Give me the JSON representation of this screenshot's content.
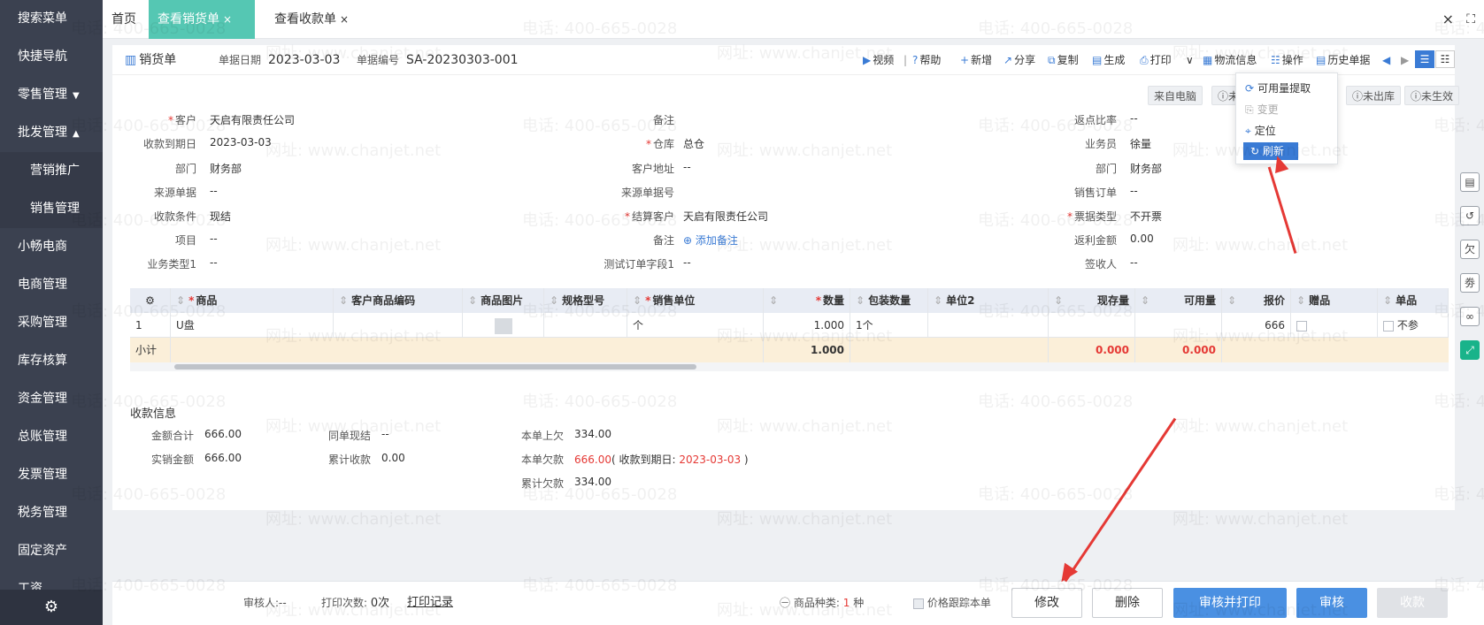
{
  "sidebar": {
    "items": [
      {
        "label": "搜索菜单"
      },
      {
        "label": "快捷导航"
      },
      {
        "label": "零售管理",
        "arrow": "▼"
      },
      {
        "label": "批发管理",
        "arrow": "▲"
      },
      {
        "label": "营销推广",
        "sub": true
      },
      {
        "label": "销售管理",
        "sub": true
      },
      {
        "label": "小畅电商"
      },
      {
        "label": "电商管理"
      },
      {
        "label": "采购管理"
      },
      {
        "label": "库存核算"
      },
      {
        "label": "资金管理"
      },
      {
        "label": "总账管理"
      },
      {
        "label": "发票管理"
      },
      {
        "label": "税务管理"
      },
      {
        "label": "固定资产"
      },
      {
        "label": "工资"
      }
    ],
    "settings_icon": "⚙"
  },
  "tabs": [
    {
      "label": "首页",
      "closable": false
    },
    {
      "label": "查看销货单",
      "closable": true,
      "active": true
    },
    {
      "label": "查看收款单",
      "closable": true
    }
  ],
  "tab_close_glyph": "×",
  "window_close": "×",
  "window_fullscreen": "⛶",
  "toolbar": {
    "doc_title": "销货单",
    "date_label": "单据日期",
    "date_value": "2023-03-03",
    "no_label": "单据编号",
    "no_value": "SA-20230303-001",
    "buttons": [
      {
        "label": "视频",
        "icon": "▶"
      },
      {
        "label": "帮助",
        "icon": "?"
      },
      {
        "label": "新增",
        "icon": "+"
      },
      {
        "label": "分享",
        "icon": "↗"
      },
      {
        "label": "复制",
        "icon": "⧉"
      },
      {
        "label": "生成",
        "icon": "▤"
      },
      {
        "label": "打印",
        "icon": "⎙"
      },
      {
        "label": "物流信息",
        "icon": "▦"
      },
      {
        "label": "操作",
        "icon": "☷"
      },
      {
        "label": "历史单据",
        "icon": "▤"
      }
    ],
    "separator": "|",
    "print_dropdown": "∨",
    "nav_prev": "◀",
    "nav_next": "▶",
    "view_list": "☰",
    "view_detail": "☷"
  },
  "status_chips": [
    "来自电脑",
    "未",
    "未出库",
    "未生效"
  ],
  "operation_menu": {
    "items": [
      {
        "label": "可用量提取",
        "icon": "⟳",
        "disabled": false
      },
      {
        "label": "变更",
        "icon": "⎘",
        "disabled": true
      },
      {
        "label": "定位",
        "icon": "⌖",
        "disabled": false
      }
    ],
    "refresh": {
      "label": "刷新",
      "icon": "↻"
    }
  },
  "form": {
    "customer_label": "客户",
    "customer_value": "天启有限责任公司",
    "remark_label": "备注",
    "rebate_label": "返点比率",
    "rebate_value": "--",
    "due_label": "收款到期日",
    "due_value": "2023-03-03",
    "warehouse_label": "仓库",
    "warehouse_value": "总仓",
    "salesman_label": "业务员",
    "salesman_value": "徐量",
    "dept_label": "部门",
    "dept_value": "财务部",
    "cust_addr_label": "客户地址",
    "cust_addr_value": "--",
    "dept2_label": "部门",
    "dept2_value": "财务部",
    "src_doc_label": "来源单据",
    "src_doc_value": "--",
    "src_no_label": "来源单据号",
    "sales_order_label": "销售订单",
    "sales_order_value": "--",
    "terms_label": "收款条件",
    "terms_value": "现结",
    "settle_label": "结算客户",
    "settle_value": "天启有限责任公司",
    "invoice_label": "票据类型",
    "invoice_value": "不开票",
    "project_label": "项目",
    "project_value": "--",
    "remark2_label": "备注",
    "remark2_value": "添加备注",
    "rebate_amt_label": "返利金额",
    "rebate_amt_value": "0.00",
    "biztype_label": "业务类型1",
    "biztype_value": "--",
    "test_label": "测试订单字段1",
    "test_value": "--",
    "receiver_label": "签收人",
    "receiver_value": "--"
  },
  "grid": {
    "settings_icon": "⚙",
    "headers": [
      "商品",
      "客户商品编码",
      "商品图片",
      "规格型号",
      "销售单位",
      "数量",
      "包装数量",
      "单位2",
      "现存量",
      "可用量",
      "报价",
      "赠品",
      "单品"
    ],
    "row": {
      "no": "1",
      "product": "U盘",
      "unit": "个",
      "qty": "1.000",
      "pack": "1个",
      "price": "666",
      "single": "不参"
    },
    "subtotal": {
      "label": "小计",
      "qty": "1.000",
      "stock": "0.000",
      "avail": "0.000"
    }
  },
  "payment": {
    "title": "收款信息",
    "total_label": "金额合计",
    "total_value": "666.00",
    "same_label": "同单现结",
    "same_value": "--",
    "prev_owe_label": "本单上欠",
    "prev_owe_value": "334.00",
    "actual_label": "实销金额",
    "actual_value": "666.00",
    "cum_recv_label": "累计收款",
    "cum_recv_value": "0.00",
    "owe_label": "本单欠款",
    "owe_value": "666.00",
    "owe_note_open": "( 收款到期日: ",
    "owe_note_date": "2023-03-03",
    "owe_note_close": " )",
    "cum_owe_label": "累计欠款",
    "cum_owe_value": "334.00"
  },
  "footer": {
    "auditor": "审核人:--",
    "print_count_label": "打印次数:",
    "print_count_value": "0次",
    "print_record": "打印记录",
    "kinds_label": "商品种类:",
    "kinds_value": "1",
    "kinds_unit": "种",
    "track_label": "价格跟踪本单",
    "btn_edit": "修改",
    "btn_delete": "删除",
    "btn_audit_print": "审核并打印",
    "btn_audit": "审核",
    "btn_receive": "收款"
  },
  "right_rail_icons": [
    "note-icon",
    "history-icon",
    "owe-icon",
    "ticket-icon",
    "link-icon",
    "expand-icon"
  ],
  "watermark": {
    "phone": "电话: 400-665-0028",
    "site": "网址: www.chanjet.net"
  },
  "colors": {
    "accent": "#3a7bd5",
    "tab_active": "#55c7b3",
    "sidebar": "#3b4150",
    "red": "#e53935",
    "primary_button": "#4a90e2"
  }
}
